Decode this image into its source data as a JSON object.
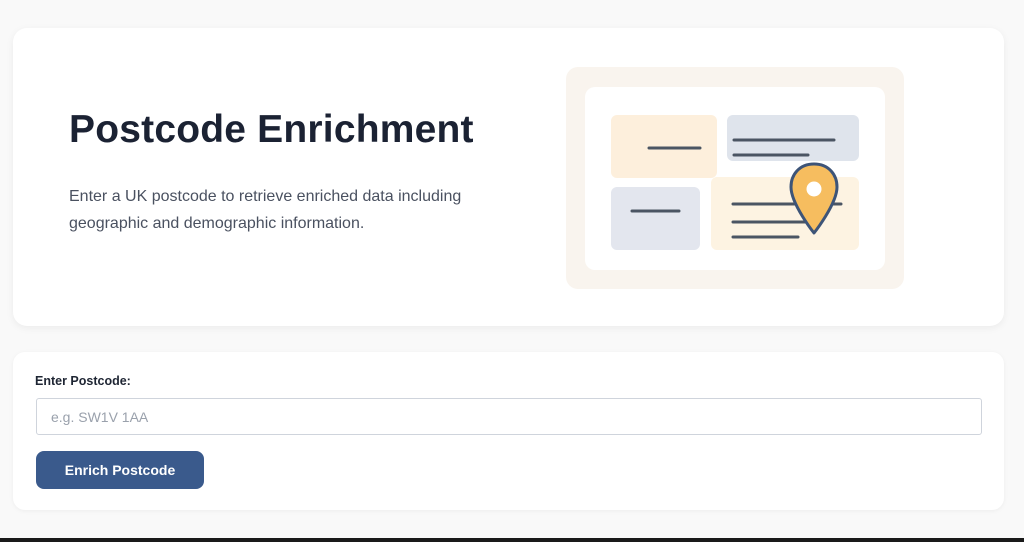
{
  "hero": {
    "title": "Postcode Enrichment",
    "description": "Enter a UK postcode to retrieve enriched data including geographic and demographic information.",
    "illustration_icon": "map-pin-icon"
  },
  "form": {
    "label": "Enter Postcode:",
    "input_value": "",
    "input_placeholder": "e.g. SW1V 1AA",
    "submit_label": "Enrich Postcode"
  },
  "colors": {
    "primary_button": "#3a5a8c",
    "title_text": "#1b2233",
    "pin_fill": "#f6bd5f",
    "pin_stroke": "#3d5478"
  }
}
